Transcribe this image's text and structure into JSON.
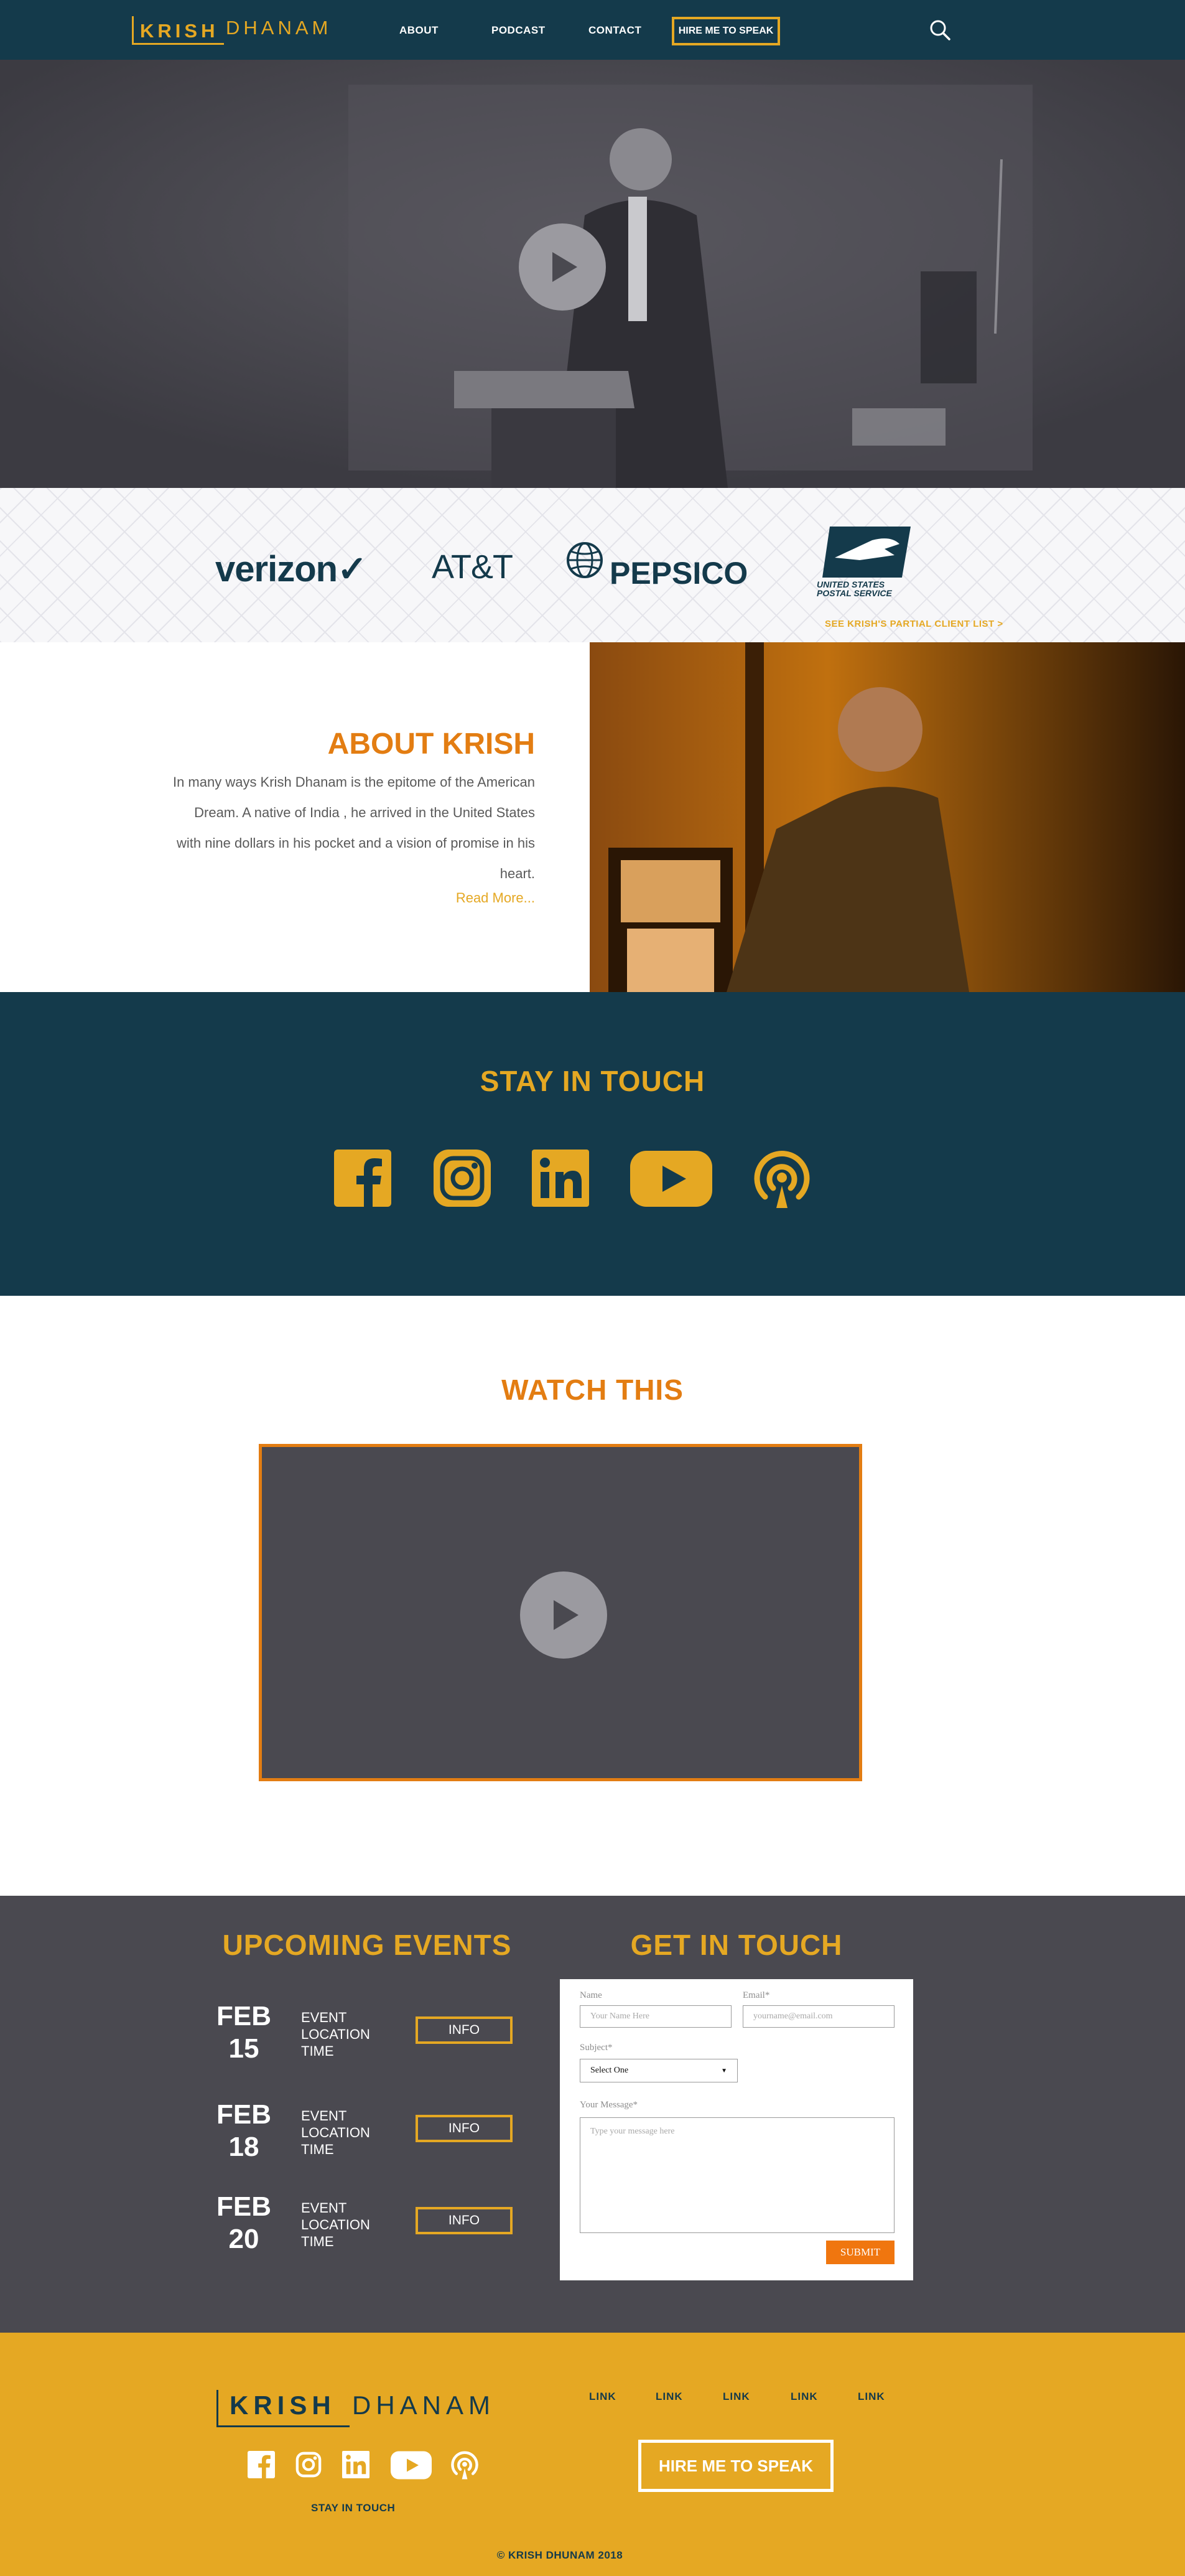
{
  "header": {
    "logo_first": "KRISH",
    "logo_last": "DHANAM",
    "nav": [
      "ABOUT",
      "PODCAST",
      "CONTACT"
    ],
    "hire_label": "HIRE ME TO SPEAK"
  },
  "clients": {
    "logos": [
      "verizon✓",
      "AT&T",
      "PEPSICO",
      "UNITED STATES POSTAL SERVICE"
    ],
    "list_link": "SEE KRISH'S PARTIAL CLIENT LIST >"
  },
  "about": {
    "title": "ABOUT KRISH",
    "body": "In many ways Krish Dhanam is the epitome of the American Dream. A native of India , he arrived in the United States with nine dollars in his pocket and a vision of promise in his heart.",
    "read_more": "Read More..."
  },
  "stay": {
    "title": "STAY IN TOUCH",
    "icons": [
      "facebook-icon",
      "instagram-icon",
      "linkedin-icon",
      "youtube-icon",
      "podcast-icon"
    ]
  },
  "watch": {
    "title": "WATCH THIS"
  },
  "events": {
    "title": "UPCOMING EVENTS",
    "items": [
      {
        "month": "FEB",
        "day": "15",
        "line1": "EVENT",
        "line2": "LOCATION",
        "line3": "TIME",
        "button": "INFO"
      },
      {
        "month": "FEB",
        "day": "18",
        "line1": "EVENT",
        "line2": "LOCATION",
        "line3": "TIME",
        "button": "INFO"
      },
      {
        "month": "FEB",
        "day": "20",
        "line1": "EVENT",
        "line2": "LOCATION",
        "line3": "TIME",
        "button": "INFO"
      }
    ]
  },
  "contact": {
    "title": "GET IN TOUCH",
    "name_label": "Name",
    "name_placeholder": "Your Name Here",
    "email_label": "Email*",
    "email_placeholder": "yourname@email.com",
    "subject_label": "Subject*",
    "subject_value": "Select One",
    "message_label": "Your Message*",
    "message_placeholder": "Type your message here",
    "submit": "SUBMIT"
  },
  "footer": {
    "logo_first": "KRISH",
    "logo_last": "DHANAM",
    "links": [
      "LINK",
      "LINK",
      "LINK",
      "LINK",
      "LINK"
    ],
    "stay_label": "STAY IN TOUCH",
    "hire_label": "HIRE ME TO SPEAK",
    "copyright": "© KRISH DHUNAM 2018"
  },
  "colors": {
    "navy": "#143a4b",
    "gold": "#e5a823",
    "orange": "#e37d12",
    "charcoal": "#4a4950",
    "submit": "#f0760f"
  }
}
